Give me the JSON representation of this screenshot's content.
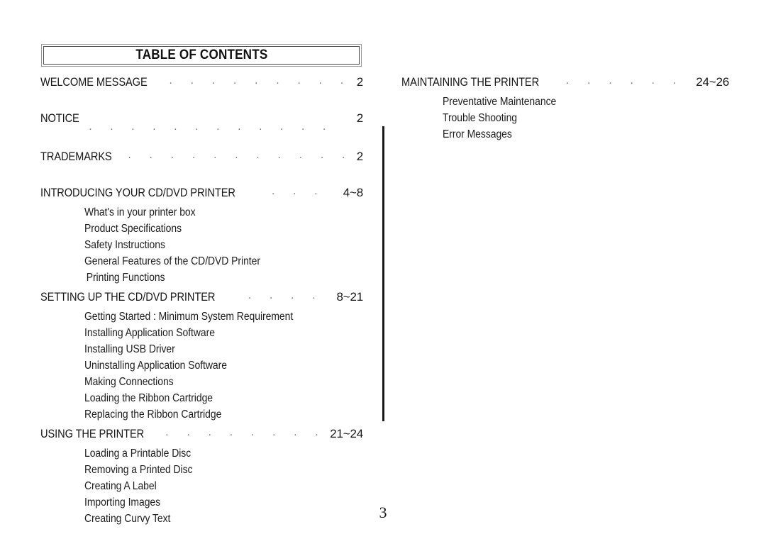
{
  "document": {
    "title": "TABLE OF CONTENTS",
    "page_number": "3"
  },
  "left_column": {
    "entries": [
      {
        "label": "WELCOME MESSAGE",
        "page": "2",
        "leader_style": "inline",
        "children": []
      },
      {
        "label": "NOTICE",
        "page": "2",
        "leader_style": "below",
        "children": []
      },
      {
        "label": "TRADEMARKS",
        "page": "2",
        "leader_style": "inline",
        "children": []
      },
      {
        "label": "INTRODUCING YOUR CD/DVD PRINTER",
        "page": "4~8",
        "leader_style": "inline",
        "children": [
          "What's in your printer box",
          "Product Specifications",
          "Safety Instructions",
          "General Features of the CD/DVD Printer",
          "Printing Functions"
        ]
      },
      {
        "label": "SETTING UP THE CD/DVD  PRINTER",
        "page": "8~21",
        "leader_style": "inline",
        "children": [
          "Getting Started : Minimum System Requirement",
          "Installing Application Software",
          "Installing USB Driver",
          "Uninstalling Application Software",
          "Making Connections",
          "Loading the Ribbon Cartridge",
          "Replacing the Ribbon Cartridge"
        ]
      },
      {
        "label": "USING THE PRINTER",
        "page": "21~24",
        "leader_style": "inline",
        "children": [
          "Loading a Printable Disc",
          "Removing a Printed Disc",
          "Creating A Label",
          "Importing Images",
          "Creating Curvy Text"
        ]
      }
    ]
  },
  "right_column": {
    "entries": [
      {
        "label": "MAINTAINING THE PRINTER",
        "page": "24~26",
        "leader_style": "inline",
        "children": [
          "Preventative Maintenance",
          "Trouble Shooting",
          "Error Messages"
        ]
      }
    ]
  }
}
